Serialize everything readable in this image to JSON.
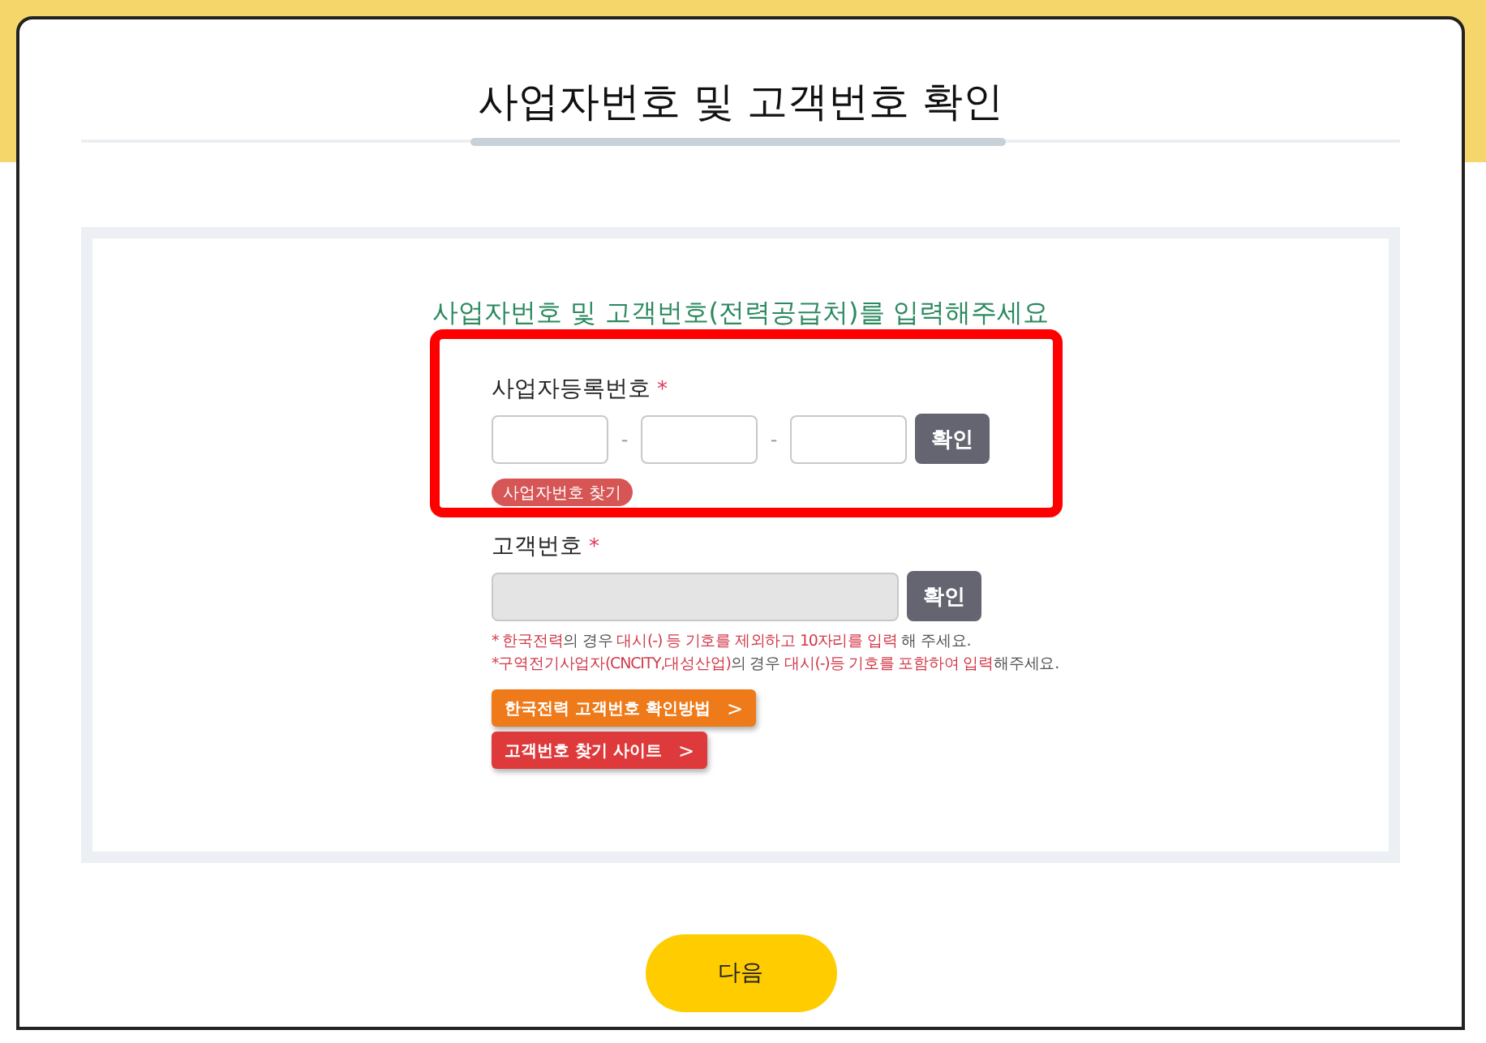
{
  "dialog": {
    "title": "사업자번호 및 고객번호 확인"
  },
  "form": {
    "heading": "사업자번호 및 고객번호(전력공급처)를 입력해주세요",
    "business_number": {
      "label": "사업자등록번호",
      "required_mark": "*",
      "separators": [
        "-",
        "-"
      ],
      "confirm_button": "확인",
      "find_button": "사업자번호 찾기"
    },
    "customer_number": {
      "label": "고객번호",
      "required_mark": "*",
      "disabled": true,
      "confirm_button": "확인"
    },
    "notes": [
      [
        {
          "text": "* 한국전력",
          "highlight": true
        },
        {
          "text": "의 경우 ",
          "highlight": false
        },
        {
          "text": "대시(-) 등 기호를 제외하고 10자리를 입력",
          "highlight": true
        },
        {
          "text": " 해 주세요.",
          "highlight": false
        }
      ],
      [
        {
          "text": "*구역전기사업자(CNCITY,대성산업)",
          "highlight": true
        },
        {
          "text": "의 경우 ",
          "highlight": false
        },
        {
          "text": "대시(-)등 기호를 포함하여 입력",
          "highlight": true
        },
        {
          "text": "해주세요.",
          "highlight": false
        }
      ]
    ],
    "links": [
      {
        "label": "한국전력 고객번호 확인방법",
        "arrow": ">",
        "kind": "orange"
      },
      {
        "label": "고객번호 찾기 사이트",
        "arrow": ">",
        "kind": "red"
      }
    ]
  },
  "next_button": "다음"
}
